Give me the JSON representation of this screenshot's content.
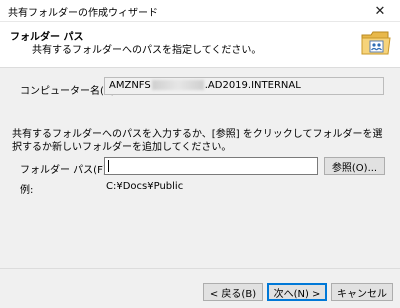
{
  "window": {
    "title": "共有フォルダーの作成ウィザード",
    "close_glyph": "✕"
  },
  "header": {
    "title": "フォルダー パス",
    "description": "共有するフォルダーへのパスを指定してください。",
    "icon": "shared-folder-wizard-icon"
  },
  "computer": {
    "label": "コンピューター名(C):",
    "value_prefix": "AMZNFS",
    "value_suffix": ".AD2019.INTERNAL"
  },
  "instructions": "共有するフォルダーへのパスを入力するか、[参照] をクリックしてフォルダーを選択するか新しいフォルダーを追加してください。",
  "folder_path": {
    "label": "フォルダー パス(F):",
    "value": "",
    "browse_label": "参照(O)..."
  },
  "example": {
    "label": "例:",
    "value": "C:¥Docs¥Public"
  },
  "buttons": {
    "back": "< 戻る(B)",
    "next": "次へ(N) >",
    "cancel": "キャンセル"
  },
  "colors": {
    "focus": "#0078d7",
    "button_bg": "#e1e1e1",
    "dialog_bg": "#f0f0f0"
  }
}
